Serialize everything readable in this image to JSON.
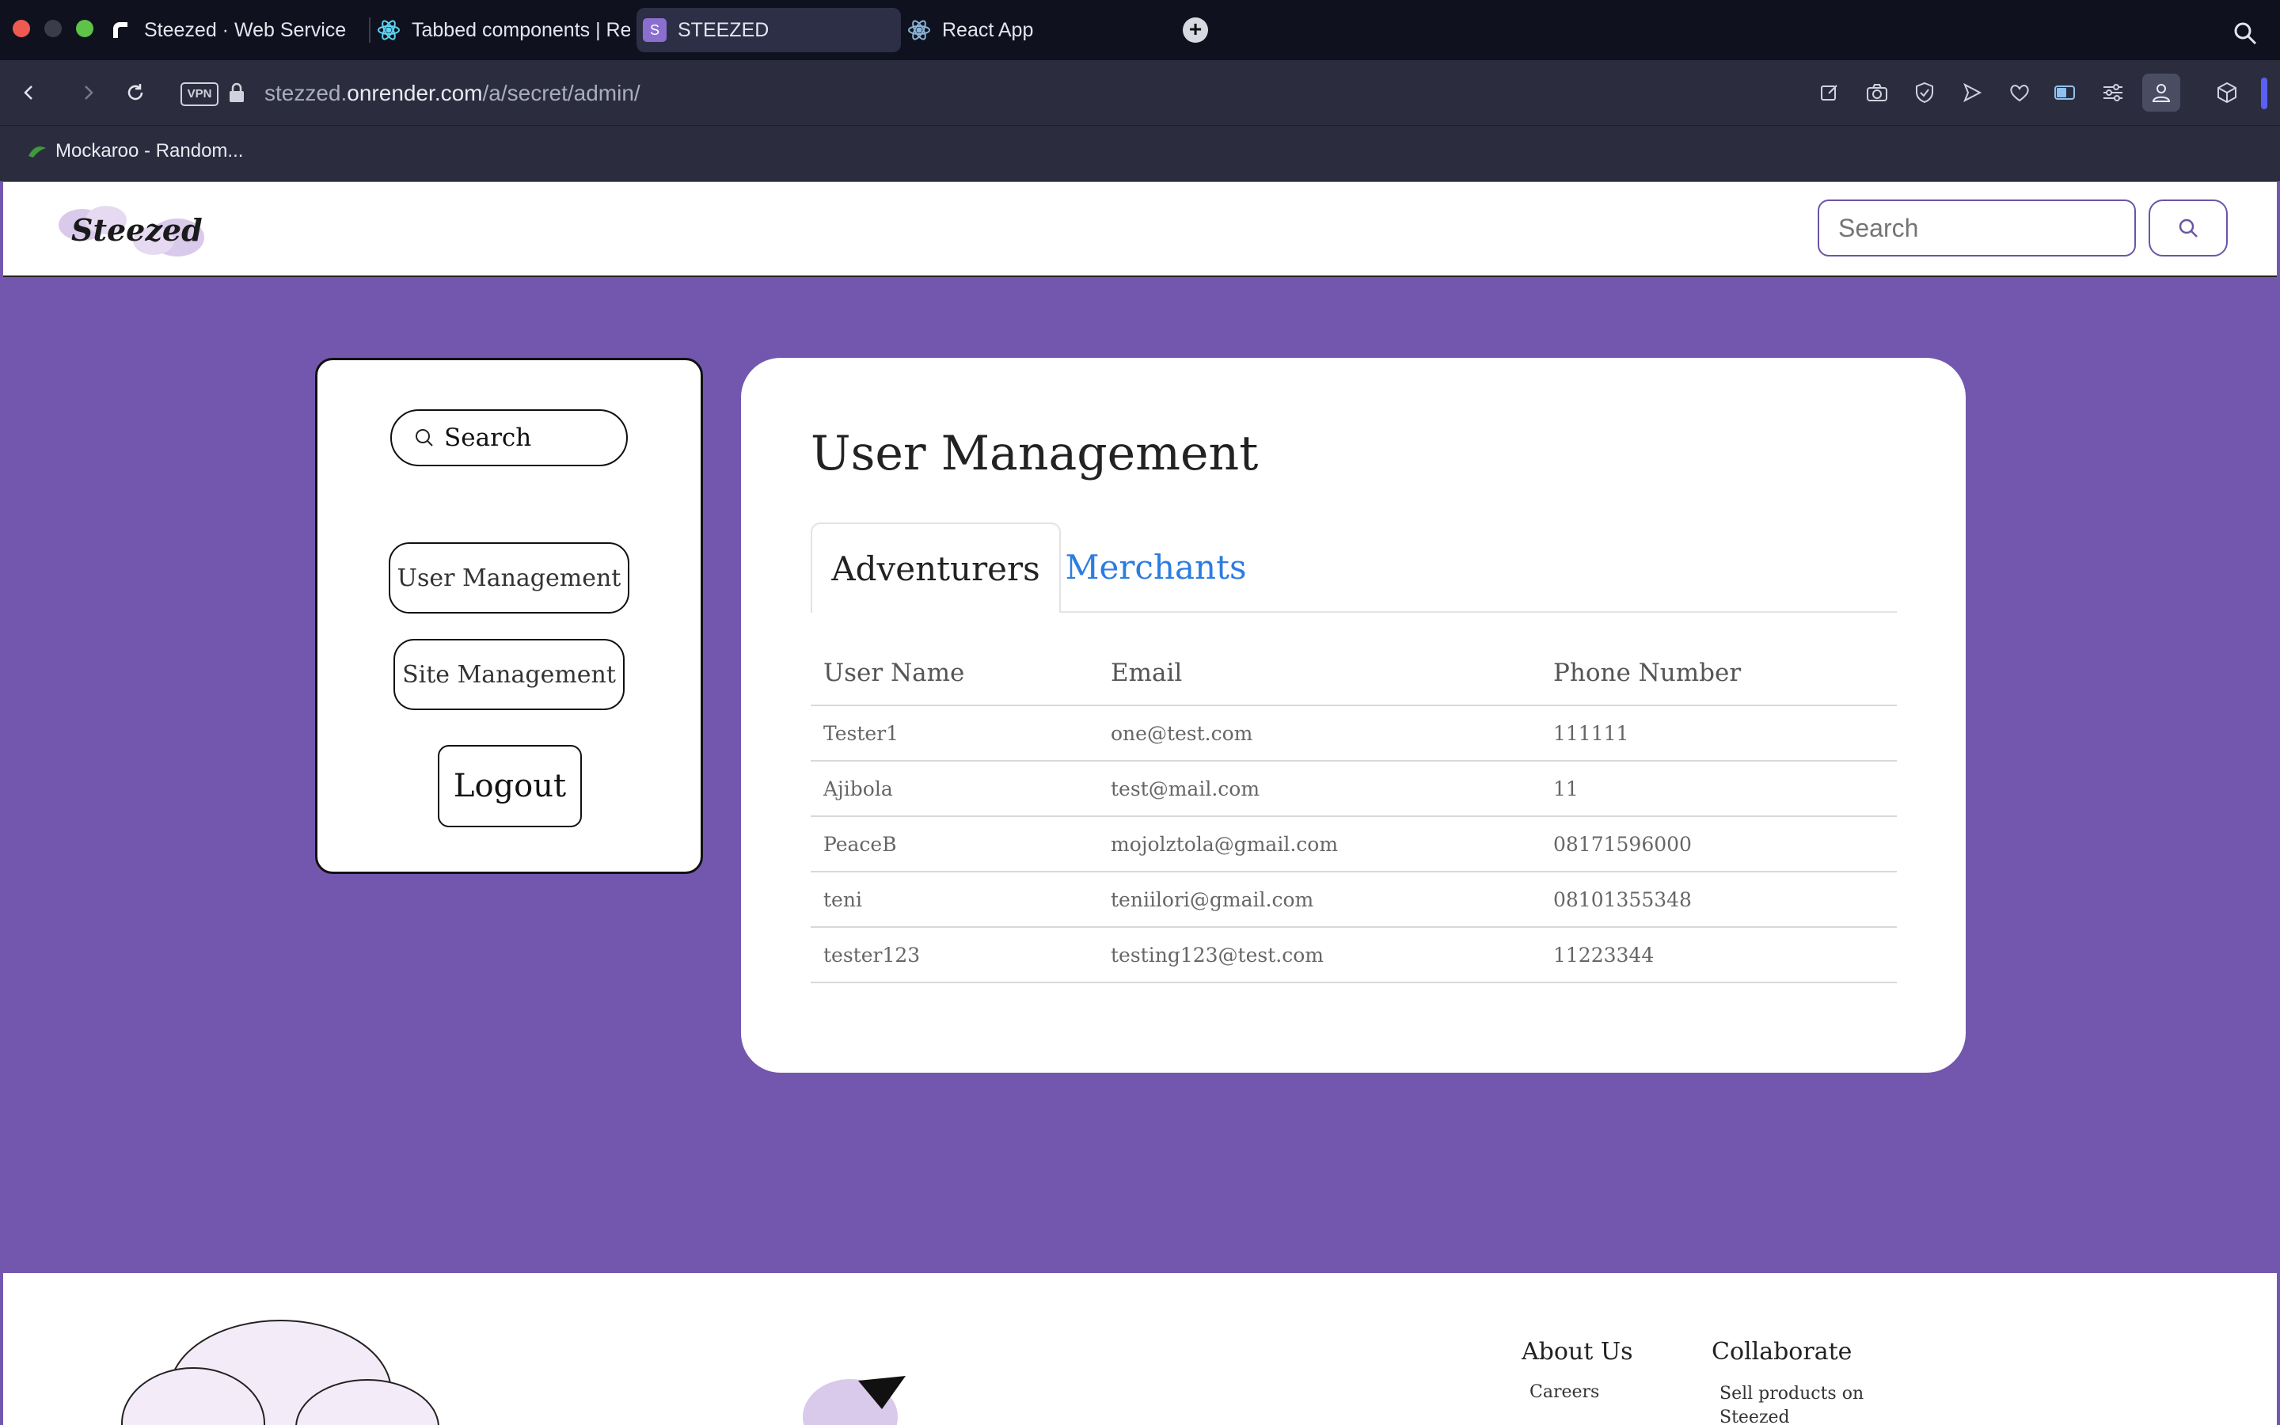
{
  "browser": {
    "tabs": [
      {
        "title": "Steezed · Web Service"
      },
      {
        "title": "Tabbed components | React"
      },
      {
        "title": "STEEZED"
      },
      {
        "title": "React App"
      }
    ],
    "vpn_label": "VPN",
    "url_host": "stezzed.",
    "url_domain": "onrender.com",
    "url_path": "/a/secret/admin/",
    "bookmarks": [
      {
        "label": "Mockaroo - Random..."
      }
    ],
    "active_tab_favicon": "S"
  },
  "header": {
    "logo_text": "Steezed",
    "search_placeholder": "Search"
  },
  "sidebar": {
    "search_label": "Search",
    "nav": [
      {
        "label": "User Management"
      },
      {
        "label": "Site Management"
      }
    ],
    "logout_label": "Logout"
  },
  "main": {
    "title": "User Management",
    "tabs": [
      {
        "label": "Adventurers",
        "active": true
      },
      {
        "label": "Merchants",
        "active": false
      }
    ],
    "table": {
      "columns": [
        "User Name",
        "Email",
        "Phone Number"
      ],
      "rows": [
        [
          "Tester1",
          "one@test.com",
          "111111"
        ],
        [
          "Ajibola",
          "test@mail.com",
          "11"
        ],
        [
          "PeaceB",
          "mojolztola@gmail.com",
          "08171596000"
        ],
        [
          "teni",
          "teniilori@gmail.com",
          "08101355348"
        ],
        [
          "tester123",
          "testing123@test.com",
          "11223344"
        ]
      ]
    }
  },
  "footer": {
    "about_heading": "About Us",
    "about_links": [
      "Careers"
    ],
    "collaborate_heading": "Collaborate",
    "collaborate_links": [
      "Sell products on Steezed"
    ]
  },
  "colors": {
    "page_bg": "#7357ae",
    "accent_tab": "#2b7de0",
    "header_border": "#6b55a8"
  }
}
